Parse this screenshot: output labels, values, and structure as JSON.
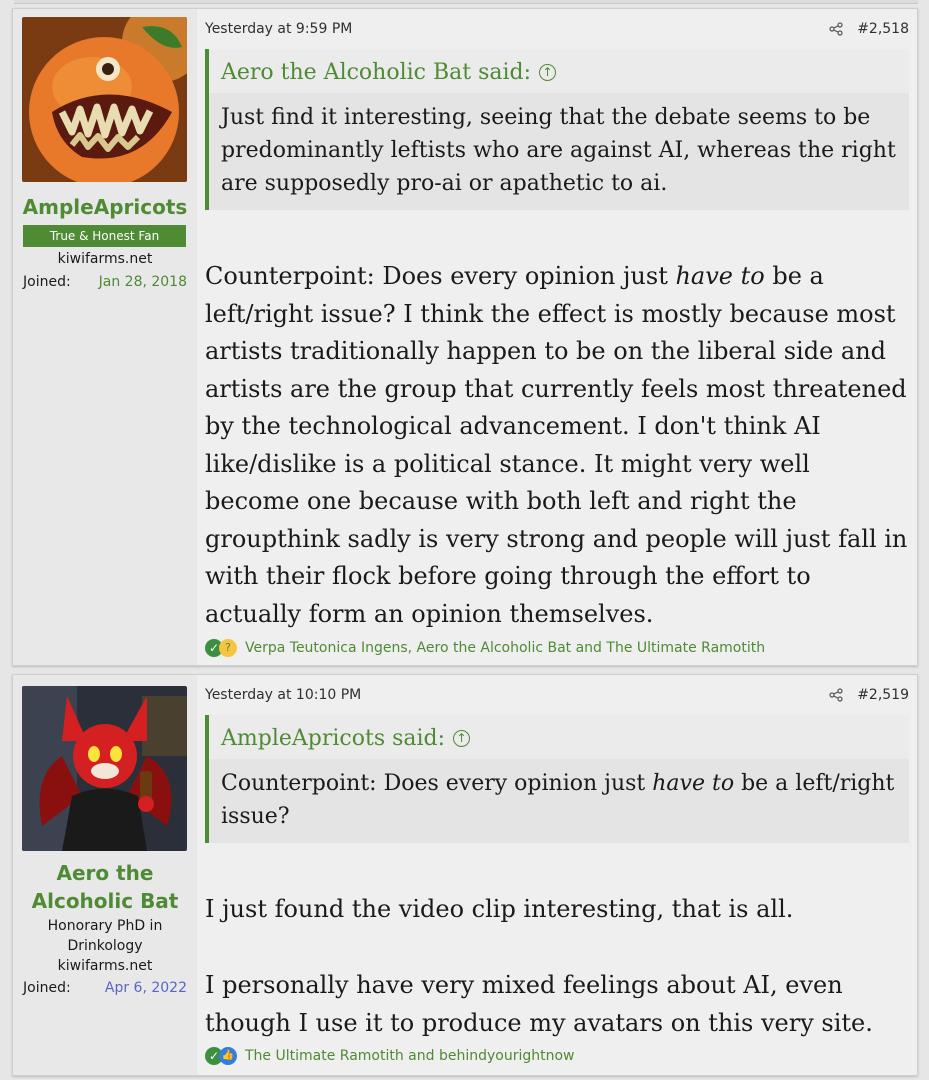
{
  "posts": [
    {
      "author": "AmpleApricots",
      "banner": "True & Honest Fan",
      "site": "kiwifarms.net",
      "joined_label": "Joined:",
      "joined_date": "Jan 28, 2018",
      "timestamp": "Yesterday at 9:59 PM",
      "post_number": "#2,518",
      "quote": {
        "author": "Aero the Alcoholic Bat said:",
        "text": "Just find it interesting, seeing that the debate seems to be predominantly leftists who are against AI, whereas the right are supposedly pro-ai or apathetic to ai."
      },
      "body_before": "Counterpoint: Does every opinion just ",
      "body_em": "have to",
      "body_after": " be a left/right issue? I think the effect is mostly because most artists traditionally happen to be on the liberal side and artists are the group that currently feels most threatened by the technological advancement. I don't think AI like/dislike is a political stance. It might very well become one because with both left and right the groupthink sadly is very strong and people will just fall in with their flock before going through the effort to actually form an opinion themselves.",
      "reactions": "Verpa Teutonica Ingens, Aero the Alcoholic Bat and The Ultimate Ramotith"
    },
    {
      "author_line1": "Aero the",
      "author_line2": "Alcoholic Bat",
      "title": "Honorary PhD in Drinkology",
      "site": "kiwifarms.net",
      "joined_label": "Joined:",
      "joined_date": "Apr 6, 2022",
      "timestamp": "Yesterday at 10:10 PM",
      "post_number": "#2,519",
      "quote": {
        "author": "AmpleApricots said:",
        "text_before": "Counterpoint: Does every opinion just ",
        "text_em": "have to",
        "text_after": " be a left/right issue?"
      },
      "body_p1": "I just found the video clip interesting, that is all.",
      "body_p2": "I personally have very mixed feelings about AI, even though I use it to produce my avatars on this very site.",
      "reactions": "The Ultimate Ramotith and behindyourightnow"
    }
  ],
  "colors": {
    "accent_green": "#4f8a34",
    "joined_blue": "#5a64c8"
  },
  "icons": [
    "share-icon",
    "quote-arrow-up-icon",
    "reaction-check-icon",
    "reaction-thinking-icon",
    "reaction-like-icon"
  ]
}
